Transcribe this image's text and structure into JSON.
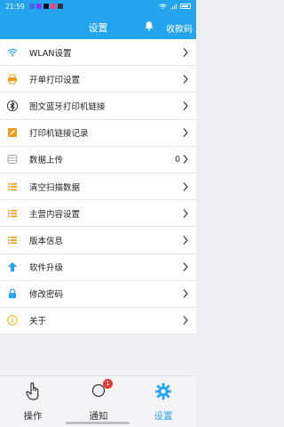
{
  "status_bar": {
    "time": "21:59"
  },
  "header": {
    "title": "设置",
    "right_label": "收款码"
  },
  "menu": [
    {
      "label": "WLAN设置",
      "icon": "wifi-icon",
      "value": ""
    },
    {
      "label": "开单打印设置",
      "icon": "printer-icon",
      "value": ""
    },
    {
      "label": "图文蓝牙打印机链接",
      "icon": "bluetooth-icon",
      "value": ""
    },
    {
      "label": "打印机链接记录",
      "icon": "record-icon",
      "value": ""
    },
    {
      "label": "数据上传",
      "icon": "upload-icon",
      "value": "0"
    },
    {
      "label": "清空扫描数据",
      "icon": "list-icon",
      "value": ""
    },
    {
      "label": "主营内容设置",
      "icon": "list-icon",
      "value": ""
    },
    {
      "label": "版本信息",
      "icon": "list-icon",
      "value": ""
    },
    {
      "label": "软件升级",
      "icon": "arrow-up-icon",
      "value": ""
    },
    {
      "label": "修改密码",
      "icon": "lock-icon",
      "value": ""
    },
    {
      "label": "关于",
      "icon": "info-icon",
      "value": ""
    }
  ],
  "tabs": [
    {
      "label": "操作",
      "icon": "hand-icon"
    },
    {
      "label": "通知",
      "icon": "bell-outline-icon",
      "badge": "1"
    },
    {
      "label": "设置",
      "icon": "gear-icon"
    }
  ],
  "colors": {
    "primary": "#23a4ec",
    "orange": "#f29a1a",
    "badge": "#e53935"
  }
}
